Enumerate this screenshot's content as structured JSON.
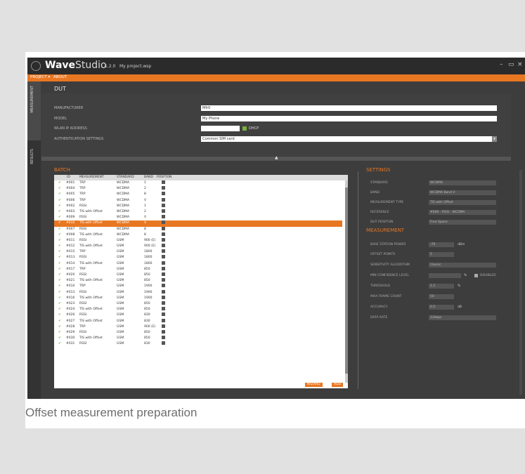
{
  "app": {
    "brand_bold": "Wave",
    "brand_light": "Studio",
    "version": "1.2.0",
    "project_name": "My project.wsp",
    "win_minimize": "–",
    "win_maximize": "▭",
    "win_close": "×"
  },
  "menu": {
    "project": "PROJECT ▾",
    "about": "ABOUT"
  },
  "sidebar": {
    "measurement": "MEASUREMENT",
    "results": "RESULTS"
  },
  "dut": {
    "title": "DUT",
    "manufacturer_label": "MANUFACTURER",
    "manufacturer_value": "Mfr0",
    "model_label": "MODEL",
    "model_value": "My Phone",
    "wlan_label": "WLAN IP ADDRESS",
    "wlan_value": "",
    "dhcp_label": "DHCP",
    "auth_label": "AUTHENTICATION SETTINGS",
    "auth_value": "Common SIM card"
  },
  "batch": {
    "title": "BATCH",
    "columns": {
      "id": "ID",
      "measurement": "MEASUREMENT",
      "standard": "STANDARD",
      "band": "BAND",
      "position": "POSITION"
    },
    "rows": [
      {
        "id": "#001",
        "m": "TRP",
        "s": "WCDMA",
        "b": "1"
      },
      {
        "id": "#004",
        "m": "TRP",
        "s": "WCDMA",
        "b": "2"
      },
      {
        "id": "#005",
        "m": "TRP",
        "s": "WCDMA",
        "b": "8"
      },
      {
        "id": "#006",
        "m": "TRP",
        "s": "WCDMA",
        "b": "V"
      },
      {
        "id": "#002",
        "m": "RSSI",
        "s": "WCDMA",
        "b": "1"
      },
      {
        "id": "#003",
        "m": "TIS with Offset",
        "s": "WCDMA",
        "b": "2"
      },
      {
        "id": "#009",
        "m": "RSSI",
        "s": "WCDMA",
        "b": "V"
      },
      {
        "id": "#010",
        "m": "TIS with Offset",
        "s": "WCDMA",
        "b": "V"
      },
      {
        "id": "#007",
        "m": "RSSI",
        "s": "WCDMA",
        "b": "8"
      },
      {
        "id": "#008",
        "m": "TIS with Offset",
        "s": "WCDMA",
        "b": "8"
      },
      {
        "id": "#011",
        "m": "RSSI",
        "s": "GSM",
        "b": "900 (E)"
      },
      {
        "id": "#012",
        "m": "TIS with Offset",
        "s": "GSM",
        "b": "900 (E)"
      },
      {
        "id": "#015",
        "m": "TRP",
        "s": "GSM",
        "b": "1800"
      },
      {
        "id": "#013",
        "m": "RSSI",
        "s": "GSM",
        "b": "1800"
      },
      {
        "id": "#014",
        "m": "TIS with Offset",
        "s": "GSM",
        "b": "1800"
      },
      {
        "id": "#017",
        "m": "TRP",
        "s": "GSM",
        "b": "850"
      },
      {
        "id": "#020",
        "m": "RSSI",
        "s": "GSM",
        "b": "850"
      },
      {
        "id": "#021",
        "m": "TIS with Offset",
        "s": "GSM",
        "b": "850"
      },
      {
        "id": "#010",
        "m": "TRP",
        "s": "GSM",
        "b": "1900"
      },
      {
        "id": "#013",
        "m": "RSSI",
        "s": "GSM",
        "b": "1900"
      },
      {
        "id": "#016",
        "m": "TIS with Offset",
        "s": "GSM",
        "b": "1900"
      },
      {
        "id": "#023",
        "m": "RSSI",
        "s": "GSM",
        "b": "850"
      },
      {
        "id": "#024",
        "m": "TIS with Offset",
        "s": "GSM",
        "b": "850"
      },
      {
        "id": "#026",
        "m": "RSSI",
        "s": "GSM",
        "b": "830"
      },
      {
        "id": "#027",
        "m": "TIS with Offset",
        "s": "GSM",
        "b": "830"
      },
      {
        "id": "#028",
        "m": "TRP",
        "s": "GSM",
        "b": "900 (E)"
      },
      {
        "id": "#029",
        "m": "RSSI",
        "s": "GSM",
        "b": "850"
      },
      {
        "id": "#030",
        "m": "TIS with Offset",
        "s": "GSM",
        "b": "850"
      },
      {
        "id": "#031",
        "m": "RSSI",
        "s": "GSM",
        "b": "830"
      }
    ],
    "selected_index": 7,
    "wizard_label": "WIZARD",
    "add_label": "ADD"
  },
  "settings": {
    "title": "SETTINGS",
    "standard_label": "STANDARD",
    "standard_value": "WCDMA",
    "band_label": "BAND",
    "band_value": "WCDMA Band V",
    "mtype_label": "MEASUREMENT TYPE",
    "mtype_value": "TIS with Offset",
    "reference_label": "REFERENCE",
    "reference_value": "#009 - RSSI - WCDMA",
    "dut_label": "DUT POSITION",
    "dut_value": "Free Space"
  },
  "measurement": {
    "title": "MEASUREMENT",
    "bs_power_label": "BASE STATION POWER",
    "bs_power_value": "-70",
    "bs_power_unit": "dBm",
    "offset_label": "OFFSET POINTS",
    "offset_value": "5",
    "sens_label": "SENSITIVITY ALGORITHM",
    "sens_value": "Classic",
    "min_conf_label": "MIN CONFIDENCE LEVEL",
    "min_conf_unit": "%",
    "disabled_label": "DISABLED",
    "threshold_label": "THRESHOLD",
    "threshold_value": "1.2",
    "threshold_unit": "%",
    "max_frame_label": "MAX FRAME COUNT",
    "max_frame_value": "50",
    "accuracy_label": "ACCURACY",
    "accuracy_value": "0.5",
    "accuracy_unit": "dB",
    "datarate_label": "DATA RATE",
    "datarate_value": "12kbps"
  },
  "caption": "Offset measurement preparation",
  "colors": {
    "accent": "#e87722",
    "ok": "#5ea02c"
  }
}
